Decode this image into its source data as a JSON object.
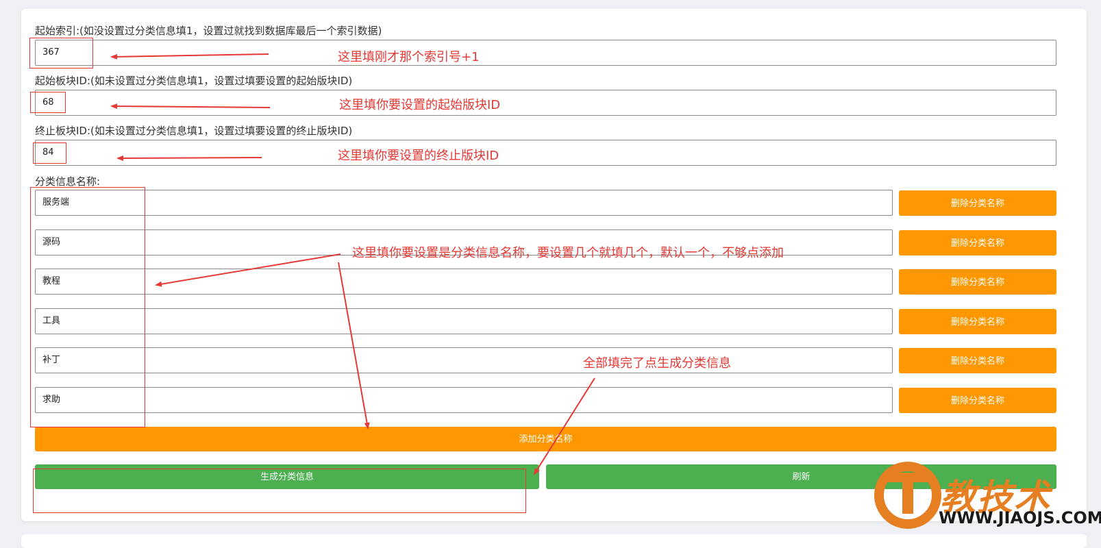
{
  "form": {
    "start_index": {
      "label": "起始索引:(如没设置过分类信息填1，设置过就找到数据库最后一个索引数据)",
      "value": "367"
    },
    "start_block": {
      "label": "起始板块ID:(如未设置过分类信息填1，设置过填要设置的起始版块ID)",
      "value": "68"
    },
    "end_block": {
      "label": "终止板块ID:(如未设置过分类信息填1，设置过填要设置的终止版块ID)",
      "value": "84"
    },
    "categories_label": "分类信息名称:",
    "categories": [
      {
        "value": "服务端",
        "delete_label": "删除分类名称"
      },
      {
        "value": "源码",
        "delete_label": "删除分类名称"
      },
      {
        "value": "教程",
        "delete_label": "删除分类名称"
      },
      {
        "value": "工具",
        "delete_label": "删除分类名称"
      },
      {
        "value": "补丁",
        "delete_label": "删除分类名称"
      },
      {
        "value": "求助",
        "delete_label": "删除分类名称"
      }
    ],
    "add_button": "添加分类名称",
    "generate_button": "生成分类信息",
    "refresh_button": "刷新"
  },
  "annotations": {
    "index_note": "这里填刚才那个索引号+1",
    "start_note": "这里填你要设置的起始版块ID",
    "end_note": "这里填你要设置的终止版块ID",
    "category_note": "这里填你要设置是分类信息名称，要设置几个就填几个，默认一个，不够点添加",
    "generate_note": "全部填完了点生成分类信息"
  },
  "watermark": {
    "brand": "教技术",
    "url": "WWW.JIAOJS.COM"
  },
  "colors": {
    "orange": "#ff9800",
    "green": "#4caf50",
    "annotation_red": "#e53935",
    "watermark_orange": "#e67e22"
  }
}
